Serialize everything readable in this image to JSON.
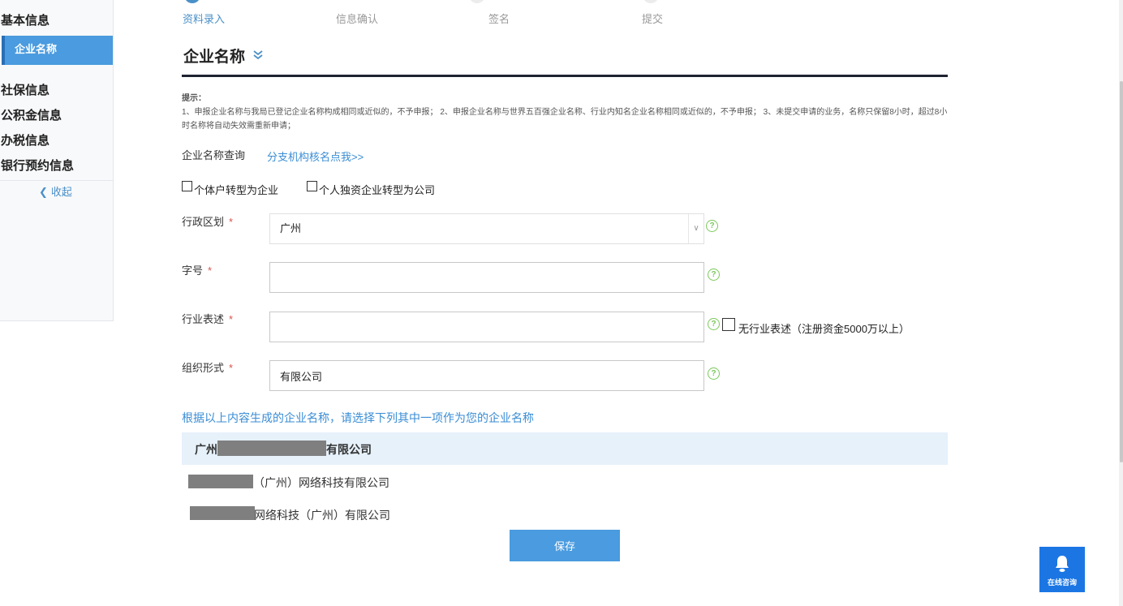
{
  "sidebar": {
    "items": [
      {
        "label": "基本信息",
        "active": false
      },
      {
        "label": "企业名称",
        "active": true
      },
      {
        "label": "社保信息",
        "active": false
      },
      {
        "label": "公积金信息",
        "active": false
      },
      {
        "label": "办税信息",
        "active": false
      },
      {
        "label": "银行预约信息",
        "active": false
      }
    ],
    "collapse_label": "收起"
  },
  "steps": [
    {
      "label": "资料录入",
      "active": true
    },
    {
      "label": "信息确认",
      "active": false
    },
    {
      "label": "签名",
      "active": false
    },
    {
      "label": "提交",
      "active": false
    }
  ],
  "section": {
    "title": "企业名称",
    "tip_label": "提示：",
    "tip_text": "1、申报企业名称与我局已登记企业名称构成相同或近似的，不予申报； 2、申报企业名称与世界五百强企业名称、行业内知名企业名称相同或近似的，不予申报； 3、未提交申请的业务，名称只保留8小时，超过8小时名称将自动失效需重新申请；"
  },
  "name_query": {
    "label": "企业名称查询",
    "link": "分支机构核名点我>>"
  },
  "checkboxes": {
    "individual_to_enterprise": "个体户转型为企业",
    "sole_to_company": "个人独资企业转型为公司"
  },
  "form": {
    "district": {
      "label": "行政区划",
      "value": "广州"
    },
    "trade_name": {
      "label": "字号",
      "value": ""
    },
    "industry": {
      "label": "行业表述",
      "value": "",
      "no_industry_label": "无行业表述（注册资金5000万以上）"
    },
    "org_form": {
      "label": "组织形式",
      "value": "有限公司"
    },
    "required_mark": "*",
    "help_glyph": "?"
  },
  "generated": {
    "prompt": "根据以上内容生成的企业名称，请选择下列其中一项作为您的企业名称",
    "options": [
      {
        "prefix": "广州",
        "suffix": "有限公司"
      },
      {
        "suffix": "（广州）网络科技有限公司"
      },
      {
        "suffix": "网络科技（广州）有限公司"
      }
    ]
  },
  "actions": {
    "save": "保存"
  },
  "online_consult": {
    "label": "在线咨询"
  },
  "colors": {
    "primary": "#4a9bdf",
    "link": "#3a8dd4",
    "help": "#7cc85c",
    "required": "#d9534f"
  }
}
